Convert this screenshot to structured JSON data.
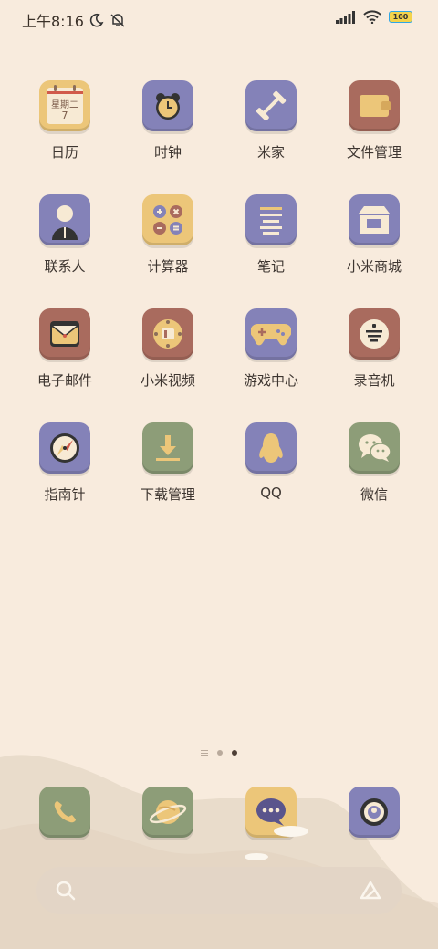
{
  "status": {
    "time": "上午8:16",
    "battery": "100"
  },
  "apps": [
    {
      "label": "日历",
      "color": "#ecc679",
      "icon": "calendar-icon",
      "calendar_text": "星期二",
      "calendar_day": "7"
    },
    {
      "label": "时钟",
      "color": "#8482b8",
      "icon": "clock-icon"
    },
    {
      "label": "米家",
      "color": "#8482b8",
      "icon": "dumbbell-icon"
    },
    {
      "label": "文件管理",
      "color": "#a96b5e",
      "icon": "wallet-icon"
    },
    {
      "label": "联系人",
      "color": "#8482b8",
      "icon": "person-icon"
    },
    {
      "label": "计算器",
      "color": "#ecc679",
      "icon": "calculator-icon"
    },
    {
      "label": "笔记",
      "color": "#8482b8",
      "icon": "notes-icon"
    },
    {
      "label": "小米商城",
      "color": "#8482b8",
      "icon": "store-icon"
    },
    {
      "label": "电子邮件",
      "color": "#a96b5e",
      "icon": "mail-icon"
    },
    {
      "label": "小米视频",
      "color": "#a96b5e",
      "icon": "video-icon"
    },
    {
      "label": "游戏中心",
      "color": "#8482b8",
      "icon": "gamepad-icon"
    },
    {
      "label": "录音机",
      "color": "#a96b5e",
      "icon": "recorder-icon"
    },
    {
      "label": "指南针",
      "color": "#8482b8",
      "icon": "compass-icon"
    },
    {
      "label": "下载管理",
      "color": "#8d9d78",
      "icon": "download-icon"
    },
    {
      "label": "QQ",
      "color": "#8482b8",
      "icon": "penguin-icon"
    },
    {
      "label": "微信",
      "color": "#8d9d78",
      "icon": "wechat-icon"
    }
  ],
  "dock": [
    {
      "name": "phone",
      "icon": "phone-icon"
    },
    {
      "name": "browser",
      "icon": "planet-icon"
    },
    {
      "name": "messages",
      "icon": "chat-bubble-icon"
    },
    {
      "name": "camera",
      "icon": "camera-icon"
    }
  ],
  "pages": {
    "count": 2,
    "current": 2
  }
}
